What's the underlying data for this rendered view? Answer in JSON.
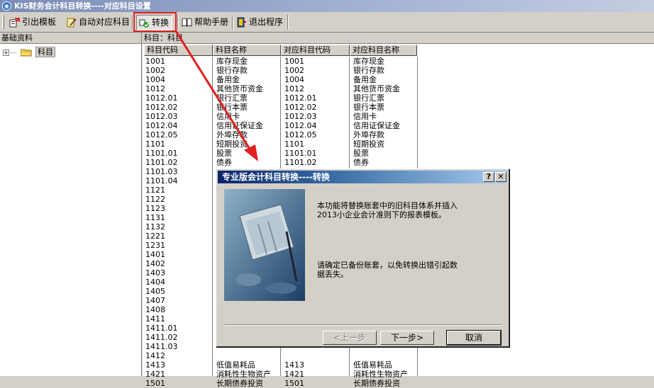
{
  "window": {
    "title": "KIS财务会计科目转换----对应科目设置",
    "icon": "kis-app-icon"
  },
  "toolbar": {
    "export_template": "引出模板",
    "auto_map": "自动对应科目",
    "convert": "转换",
    "help_manual": "帮助手册",
    "exit_program": "退出程序"
  },
  "left_panel": {
    "header": "基础资料",
    "tree_root": "科目"
  },
  "right_panel": {
    "header": "科目：科目",
    "columns": [
      "科目代码",
      "科目名称",
      "对应科目代码",
      "对应科目名称"
    ],
    "rows": [
      [
        "1001",
        "库存现金",
        "1001",
        "库存现金"
      ],
      [
        "1002",
        "银行存款",
        "1002",
        "银行存款"
      ],
      [
        "1004",
        "备用金",
        "1004",
        "备用金"
      ],
      [
        "1012",
        "其他货币资金",
        "1012",
        "其他货币资金"
      ],
      [
        "1012.01",
        "银行汇票",
        "1012.01",
        "银行汇票"
      ],
      [
        "1012.02",
        "银行本票",
        "1012.02",
        "银行本票"
      ],
      [
        "1012.03",
        "信用卡",
        "1012.03",
        "信用卡"
      ],
      [
        "1012.04",
        "信用证保证金",
        "1012.04",
        "信用证保证金"
      ],
      [
        "1012.05",
        "外埠存款",
        "1012.05",
        "外埠存款"
      ],
      [
        "1101",
        "短期投资",
        "1101",
        "短期投资"
      ],
      [
        "1101.01",
        "股票",
        "1101.01",
        "股票"
      ],
      [
        "1101.02",
        "债券",
        "1101.02",
        "债券"
      ],
      [
        "1101.03",
        "",
        "",
        ""
      ],
      [
        "1101.04",
        "",
        "",
        ""
      ],
      [
        "1121",
        "",
        "",
        ""
      ],
      [
        "1122",
        "",
        "",
        ""
      ],
      [
        "1123",
        "",
        "",
        ""
      ],
      [
        "1131",
        "",
        "",
        ""
      ],
      [
        "1132",
        "",
        "",
        ""
      ],
      [
        "1221",
        "",
        "",
        ""
      ],
      [
        "1231",
        "",
        "",
        ""
      ],
      [
        "1401",
        "",
        "",
        ""
      ],
      [
        "1402",
        "",
        "",
        ""
      ],
      [
        "1403",
        "",
        "",
        ""
      ],
      [
        "1404",
        "",
        "",
        ""
      ],
      [
        "1405",
        "",
        "",
        ""
      ],
      [
        "1407",
        "",
        "",
        ""
      ],
      [
        "1408",
        "",
        "",
        ""
      ],
      [
        "1411",
        "",
        "",
        ""
      ],
      [
        "1411.01",
        "",
        "",
        ""
      ],
      [
        "1411.02",
        "",
        "",
        ""
      ],
      [
        "1411.03",
        "",
        "",
        ""
      ],
      [
        "1412",
        "",
        "",
        ""
      ],
      [
        "1413",
        "低值易耗品",
        "1413",
        "低值易耗品"
      ],
      [
        "1421",
        "消耗性生物资产",
        "1421",
        "消耗性生物资产"
      ],
      [
        "1501",
        "长期债券投资",
        "1501",
        "长期债券投资"
      ]
    ]
  },
  "dialog": {
    "title": "专业版会计科目转换----转换",
    "help_glyph": "?",
    "close_glyph": "✕",
    "text1_line1": "本功能将替换账套中的旧科目体系并插入",
    "text1_line2": "2013小企业会计准则下的报表模板。",
    "text2_line1": "请确定已备份账套，以免转换出错引起数",
    "text2_line2": "据丢失。",
    "prev_button": "<上一步",
    "next_button": "下一步>",
    "cancel_button": "取消"
  },
  "colors": {
    "annotation_red": "#e02020",
    "dialog_title": "#0a246a"
  }
}
